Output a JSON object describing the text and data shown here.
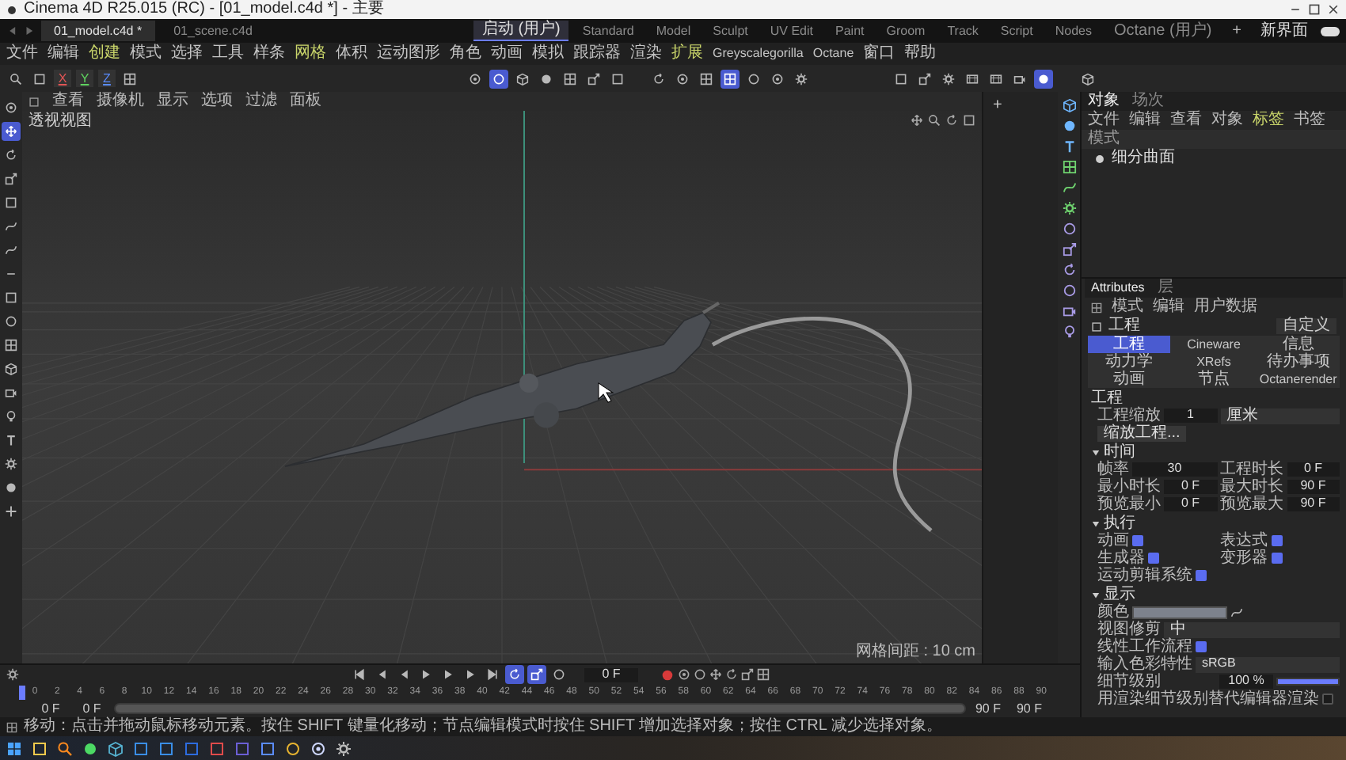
{
  "window": {
    "title": "Cinema 4D R25.015 (RC) - [01_model.c4d *] - 主要"
  },
  "document_tabs": [
    {
      "label": "01_model.c4d *",
      "selected": true
    },
    {
      "label": "01_scene.c4d",
      "selected": false
    }
  ],
  "layouts": [
    {
      "label": "启动 (用户)",
      "selected": true
    },
    {
      "label": "Standard",
      "selected": false
    },
    {
      "label": "Model",
      "selected": false
    },
    {
      "label": "Sculpt",
      "selected": false
    },
    {
      "label": "UV Edit",
      "selected": false
    },
    {
      "label": "Paint",
      "selected": false
    },
    {
      "label": "Groom",
      "selected": false
    },
    {
      "label": "Track",
      "selected": false
    },
    {
      "label": "Script",
      "selected": false
    },
    {
      "label": "Nodes",
      "selected": false
    },
    {
      "label": "Octane (用户)",
      "selected": false
    }
  ],
  "add_layout": "+",
  "new_layout": "新界面",
  "layout_toggle": {
    "on": true
  },
  "menu": [
    "文件",
    "编辑",
    "创建",
    "模式",
    "选择",
    "工具",
    "样条",
    "网格",
    "体积",
    "运动图形",
    "角色",
    "动画",
    "模拟",
    "跟踪器",
    "渲染",
    "扩展",
    "Greyscalegorilla",
    "Octane",
    "窗口",
    "帮助"
  ],
  "toolbar": {
    "axes": [
      "X",
      "Y",
      "Z"
    ],
    "mode_tools": [
      {
        "selected": false
      },
      {
        "selected": true
      },
      {
        "selected": false
      },
      {
        "selected": false
      },
      {
        "selected": false
      },
      {
        "selected": false
      },
      {
        "selected": false
      }
    ],
    "snap_tools": [
      {
        "selected": false
      },
      {
        "selected": false
      },
      {
        "selected": false
      },
      {
        "selected": true
      },
      {
        "selected": false
      },
      {
        "selected": false
      },
      {
        "selected": false
      }
    ],
    "render_tools": [
      {
        "selected": false
      },
      {
        "selected": false
      },
      {
        "selected": false
      },
      {
        "selected": false
      },
      {
        "selected": false
      },
      {
        "selected": false
      },
      {
        "selected": true
      }
    ]
  },
  "left_tools": [
    {
      "selected": false
    },
    {
      "selected": true
    },
    {
      "selected": false
    },
    {
      "selected": false
    },
    {
      "selected": false
    },
    {
      "selected": false
    },
    {
      "selected": false
    },
    {
      "selected": false
    },
    {
      "selected": false
    },
    {
      "selected": false
    },
    {
      "selected": false
    },
    {
      "selected": false
    },
    {
      "selected": false
    },
    {
      "selected": false
    },
    {
      "selected": false
    },
    {
      "selected": false
    },
    {
      "selected": false
    },
    {
      "selected": false
    }
  ],
  "viewport": {
    "menu": [
      "查看",
      "摄像机",
      "显示",
      "选项",
      "过滤",
      "面板"
    ],
    "label": "透视视图",
    "grid_spacing": "网格间距 : 10 cm"
  },
  "side_panel": {
    "add": "+"
  },
  "objects": {
    "tabs": [
      {
        "label": "对象",
        "selected": true
      },
      {
        "label": "场次",
        "selected": false
      }
    ],
    "menu": [
      "文件",
      "编辑",
      "查看",
      "对象",
      "标签",
      "书签"
    ],
    "header": "模式",
    "items": [
      {
        "name": "细分曲面"
      }
    ]
  },
  "attributes": {
    "tabs": [
      {
        "label": "Attributes",
        "selected": true
      },
      {
        "label": "层",
        "selected": false
      }
    ],
    "menu": [
      "模式",
      "编辑",
      "用户数据"
    ],
    "title": "工程",
    "preset": "自定义",
    "pages": [
      {
        "label": "工程",
        "selected": true
      },
      {
        "label": "Cineware",
        "selected": false
      },
      {
        "label": "信息",
        "selected": false
      },
      {
        "label": "动力学",
        "selected": false
      },
      {
        "label": "XRefs",
        "selected": false
      },
      {
        "label": "待办事项",
        "selected": false
      },
      {
        "label": "动画",
        "selected": false
      },
      {
        "label": "节点",
        "selected": false
      },
      {
        "label": "Octanerender",
        "selected": false
      }
    ],
    "sections": [
      {
        "title": "工程",
        "rows": [
          [
            {
              "kind": "number",
              "label": "工程缩放",
              "value": "1"
            },
            {
              "kind": "dropdown",
              "value": "厘米"
            }
          ],
          [
            {
              "kind": "button",
              "label": "缩放工程..."
            }
          ]
        ]
      },
      {
        "title": "时间",
        "expanded": true,
        "rows": [
          [
            {
              "kind": "number",
              "label": "帧率",
              "value": "30"
            },
            {
              "kind": "number",
              "label": "工程时长",
              "value": "0 F"
            }
          ],
          [
            {
              "kind": "number",
              "label": "最小时长",
              "value": "0 F"
            },
            {
              "kind": "number",
              "label": "最大时长",
              "value": "90 F"
            }
          ],
          [
            {
              "kind": "number",
              "label": "预览最小",
              "value": "0 F"
            },
            {
              "kind": "number",
              "label": "预览最大",
              "value": "90 F"
            }
          ]
        ]
      },
      {
        "title": "执行",
        "expanded": true,
        "rows": [
          [
            {
              "kind": "check",
              "label": "动画",
              "checked": true
            },
            {
              "kind": "check",
              "label": "表达式",
              "checked": true
            }
          ],
          [
            {
              "kind": "check",
              "label": "生成器",
              "checked": true
            },
            {
              "kind": "check",
              "label": "变形器",
              "checked": true
            }
          ],
          [
            {
              "kind": "check",
              "label": "运动剪辑系统",
              "checked": true
            }
          ]
        ]
      },
      {
        "title": "显示",
        "expanded": true,
        "rows": [
          [
            {
              "kind": "color",
              "label": "颜色",
              "color": "#7d828c"
            }
          ],
          [
            {
              "kind": "dropdown",
              "label": "视图修剪",
              "value": "中"
            }
          ],
          [
            {
              "kind": "check",
              "label": "线性工作流程",
              "checked": true
            }
          ],
          [
            {
              "kind": "dropdown",
              "label": "输入色彩特性",
              "value": "sRGB"
            }
          ],
          [
            {
              "kind": "slider",
              "label": "细节级别",
              "value": "100 %",
              "level": 1
            }
          ],
          [
            {
              "kind": "check",
              "label": "用渲染细节级别替代编辑器渲染",
              "checked": false
            }
          ]
        ]
      }
    ]
  },
  "timeline": {
    "buttons": [
      {
        "selected": false
      },
      {
        "selected": false
      },
      {
        "selected": false
      },
      {
        "selected": false
      },
      {
        "selected": false
      },
      {
        "selected": false
      },
      {
        "selected": false
      },
      {
        "selected": true
      },
      {
        "selected": true
      },
      {
        "selected": false
      }
    ],
    "current_frame": "0 F",
    "ticks": [
      "0",
      "2",
      "4",
      "6",
      "8",
      "10",
      "12",
      "14",
      "16",
      "18",
      "20",
      "22",
      "24",
      "26",
      "28",
      "30",
      "32",
      "34",
      "36",
      "38",
      "40",
      "42",
      "44",
      "46",
      "48",
      "50",
      "52",
      "54",
      "56",
      "58",
      "60",
      "62",
      "64",
      "66",
      "68",
      "70",
      "72",
      "74",
      "76",
      "78",
      "80",
      "82",
      "84",
      "86",
      "88",
      "90"
    ],
    "range": [
      "0 F",
      "0 F",
      "90 F",
      "90 F"
    ],
    "range_bar": {
      "level": 1
    }
  },
  "status_bar": "移动：点击并拖动鼠标移动元素。按住 SHIFT 键量化移动；节点编辑模式时按住 SHIFT 增加选择对象；按住 CTRL 减少选择对象。"
}
